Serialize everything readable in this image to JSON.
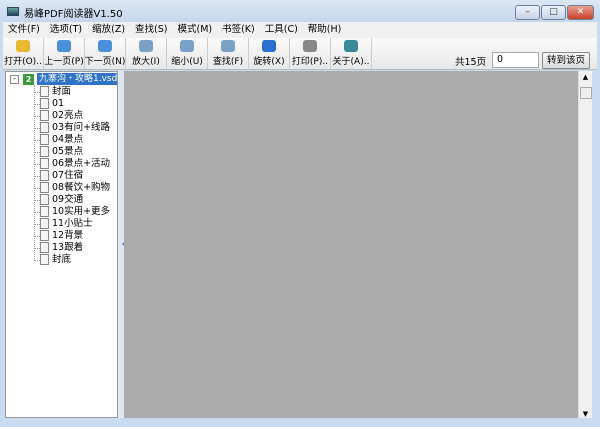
{
  "window": {
    "title": "易峰PDF阅读器V1.50",
    "minimize": "–",
    "maximize": "□",
    "close": "✕"
  },
  "menu": [
    "文件(F)",
    "选项(T)",
    "缩放(Z)",
    "查找(S)",
    "模式(M)",
    "书签(K)",
    "工具(C)",
    "帮助(H)"
  ],
  "toolbar": [
    {
      "label": "打开(O)..",
      "icon": "open-folder-icon",
      "color": "#e8b830"
    },
    {
      "label": "上一页(P)",
      "icon": "arrow-left-icon",
      "color": "#4a90d9"
    },
    {
      "label": "下一页(N)",
      "icon": "arrow-right-icon",
      "color": "#4a90d9"
    },
    {
      "label": "放大(I)",
      "icon": "zoom-in-icon",
      "color": "#7aa0c8"
    },
    {
      "label": "缩小(U)",
      "icon": "zoom-out-icon",
      "color": "#7aa0c8"
    },
    {
      "label": "查找(F)",
      "icon": "search-icon",
      "color": "#7aa0c8"
    },
    {
      "label": "旋转(X)",
      "icon": "rotate-icon",
      "color": "#2a6fd0"
    },
    {
      "label": "打印(P)..",
      "icon": "print-icon",
      "color": "#888888"
    },
    {
      "label": "关于(A)..",
      "icon": "about-icon",
      "color": "#3a8a9a"
    }
  ],
  "pager": {
    "total": "共15页",
    "page": "0",
    "go": "转到该页"
  },
  "tree": {
    "root": "九寨沟・攻略1.vsd",
    "items": [
      "封面",
      "01",
      "02亮点",
      "03有问+线路",
      "04景点",
      "05景点",
      "06景点+活动",
      "07住宿",
      "08餐饮+购物",
      "09交通",
      "10实用+更多",
      "11小贴士",
      "12背景",
      "13跟着",
      "封底"
    ]
  }
}
